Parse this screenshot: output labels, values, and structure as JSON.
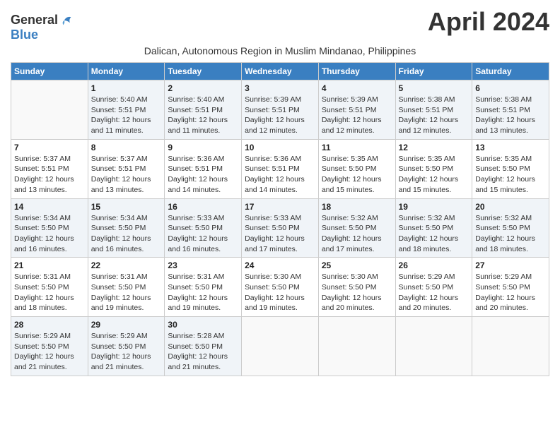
{
  "header": {
    "logo_general": "General",
    "logo_blue": "Blue",
    "month_title": "April 2024",
    "subtitle": "Dalican, Autonomous Region in Muslim Mindanao, Philippines"
  },
  "days_of_week": [
    "Sunday",
    "Monday",
    "Tuesday",
    "Wednesday",
    "Thursday",
    "Friday",
    "Saturday"
  ],
  "weeks": [
    [
      {
        "day": "",
        "info": ""
      },
      {
        "day": "1",
        "info": "Sunrise: 5:40 AM\nSunset: 5:51 PM\nDaylight: 12 hours\nand 11 minutes."
      },
      {
        "day": "2",
        "info": "Sunrise: 5:40 AM\nSunset: 5:51 PM\nDaylight: 12 hours\nand 11 minutes."
      },
      {
        "day": "3",
        "info": "Sunrise: 5:39 AM\nSunset: 5:51 PM\nDaylight: 12 hours\nand 12 minutes."
      },
      {
        "day": "4",
        "info": "Sunrise: 5:39 AM\nSunset: 5:51 PM\nDaylight: 12 hours\nand 12 minutes."
      },
      {
        "day": "5",
        "info": "Sunrise: 5:38 AM\nSunset: 5:51 PM\nDaylight: 12 hours\nand 12 minutes."
      },
      {
        "day": "6",
        "info": "Sunrise: 5:38 AM\nSunset: 5:51 PM\nDaylight: 12 hours\nand 13 minutes."
      }
    ],
    [
      {
        "day": "7",
        "info": "Sunrise: 5:37 AM\nSunset: 5:51 PM\nDaylight: 12 hours\nand 13 minutes."
      },
      {
        "day": "8",
        "info": "Sunrise: 5:37 AM\nSunset: 5:51 PM\nDaylight: 12 hours\nand 13 minutes."
      },
      {
        "day": "9",
        "info": "Sunrise: 5:36 AM\nSunset: 5:51 PM\nDaylight: 12 hours\nand 14 minutes."
      },
      {
        "day": "10",
        "info": "Sunrise: 5:36 AM\nSunset: 5:51 PM\nDaylight: 12 hours\nand 14 minutes."
      },
      {
        "day": "11",
        "info": "Sunrise: 5:35 AM\nSunset: 5:50 PM\nDaylight: 12 hours\nand 15 minutes."
      },
      {
        "day": "12",
        "info": "Sunrise: 5:35 AM\nSunset: 5:50 PM\nDaylight: 12 hours\nand 15 minutes."
      },
      {
        "day": "13",
        "info": "Sunrise: 5:35 AM\nSunset: 5:50 PM\nDaylight: 12 hours\nand 15 minutes."
      }
    ],
    [
      {
        "day": "14",
        "info": "Sunrise: 5:34 AM\nSunset: 5:50 PM\nDaylight: 12 hours\nand 16 minutes."
      },
      {
        "day": "15",
        "info": "Sunrise: 5:34 AM\nSunset: 5:50 PM\nDaylight: 12 hours\nand 16 minutes."
      },
      {
        "day": "16",
        "info": "Sunrise: 5:33 AM\nSunset: 5:50 PM\nDaylight: 12 hours\nand 16 minutes."
      },
      {
        "day": "17",
        "info": "Sunrise: 5:33 AM\nSunset: 5:50 PM\nDaylight: 12 hours\nand 17 minutes."
      },
      {
        "day": "18",
        "info": "Sunrise: 5:32 AM\nSunset: 5:50 PM\nDaylight: 12 hours\nand 17 minutes."
      },
      {
        "day": "19",
        "info": "Sunrise: 5:32 AM\nSunset: 5:50 PM\nDaylight: 12 hours\nand 18 minutes."
      },
      {
        "day": "20",
        "info": "Sunrise: 5:32 AM\nSunset: 5:50 PM\nDaylight: 12 hours\nand 18 minutes."
      }
    ],
    [
      {
        "day": "21",
        "info": "Sunrise: 5:31 AM\nSunset: 5:50 PM\nDaylight: 12 hours\nand 18 minutes."
      },
      {
        "day": "22",
        "info": "Sunrise: 5:31 AM\nSunset: 5:50 PM\nDaylight: 12 hours\nand 19 minutes."
      },
      {
        "day": "23",
        "info": "Sunrise: 5:31 AM\nSunset: 5:50 PM\nDaylight: 12 hours\nand 19 minutes."
      },
      {
        "day": "24",
        "info": "Sunrise: 5:30 AM\nSunset: 5:50 PM\nDaylight: 12 hours\nand 19 minutes."
      },
      {
        "day": "25",
        "info": "Sunrise: 5:30 AM\nSunset: 5:50 PM\nDaylight: 12 hours\nand 20 minutes."
      },
      {
        "day": "26",
        "info": "Sunrise: 5:29 AM\nSunset: 5:50 PM\nDaylight: 12 hours\nand 20 minutes."
      },
      {
        "day": "27",
        "info": "Sunrise: 5:29 AM\nSunset: 5:50 PM\nDaylight: 12 hours\nand 20 minutes."
      }
    ],
    [
      {
        "day": "28",
        "info": "Sunrise: 5:29 AM\nSunset: 5:50 PM\nDaylight: 12 hours\nand 21 minutes."
      },
      {
        "day": "29",
        "info": "Sunrise: 5:29 AM\nSunset: 5:50 PM\nDaylight: 12 hours\nand 21 minutes."
      },
      {
        "day": "30",
        "info": "Sunrise: 5:28 AM\nSunset: 5:50 PM\nDaylight: 12 hours\nand 21 minutes."
      },
      {
        "day": "",
        "info": ""
      },
      {
        "day": "",
        "info": ""
      },
      {
        "day": "",
        "info": ""
      },
      {
        "day": "",
        "info": ""
      }
    ]
  ]
}
